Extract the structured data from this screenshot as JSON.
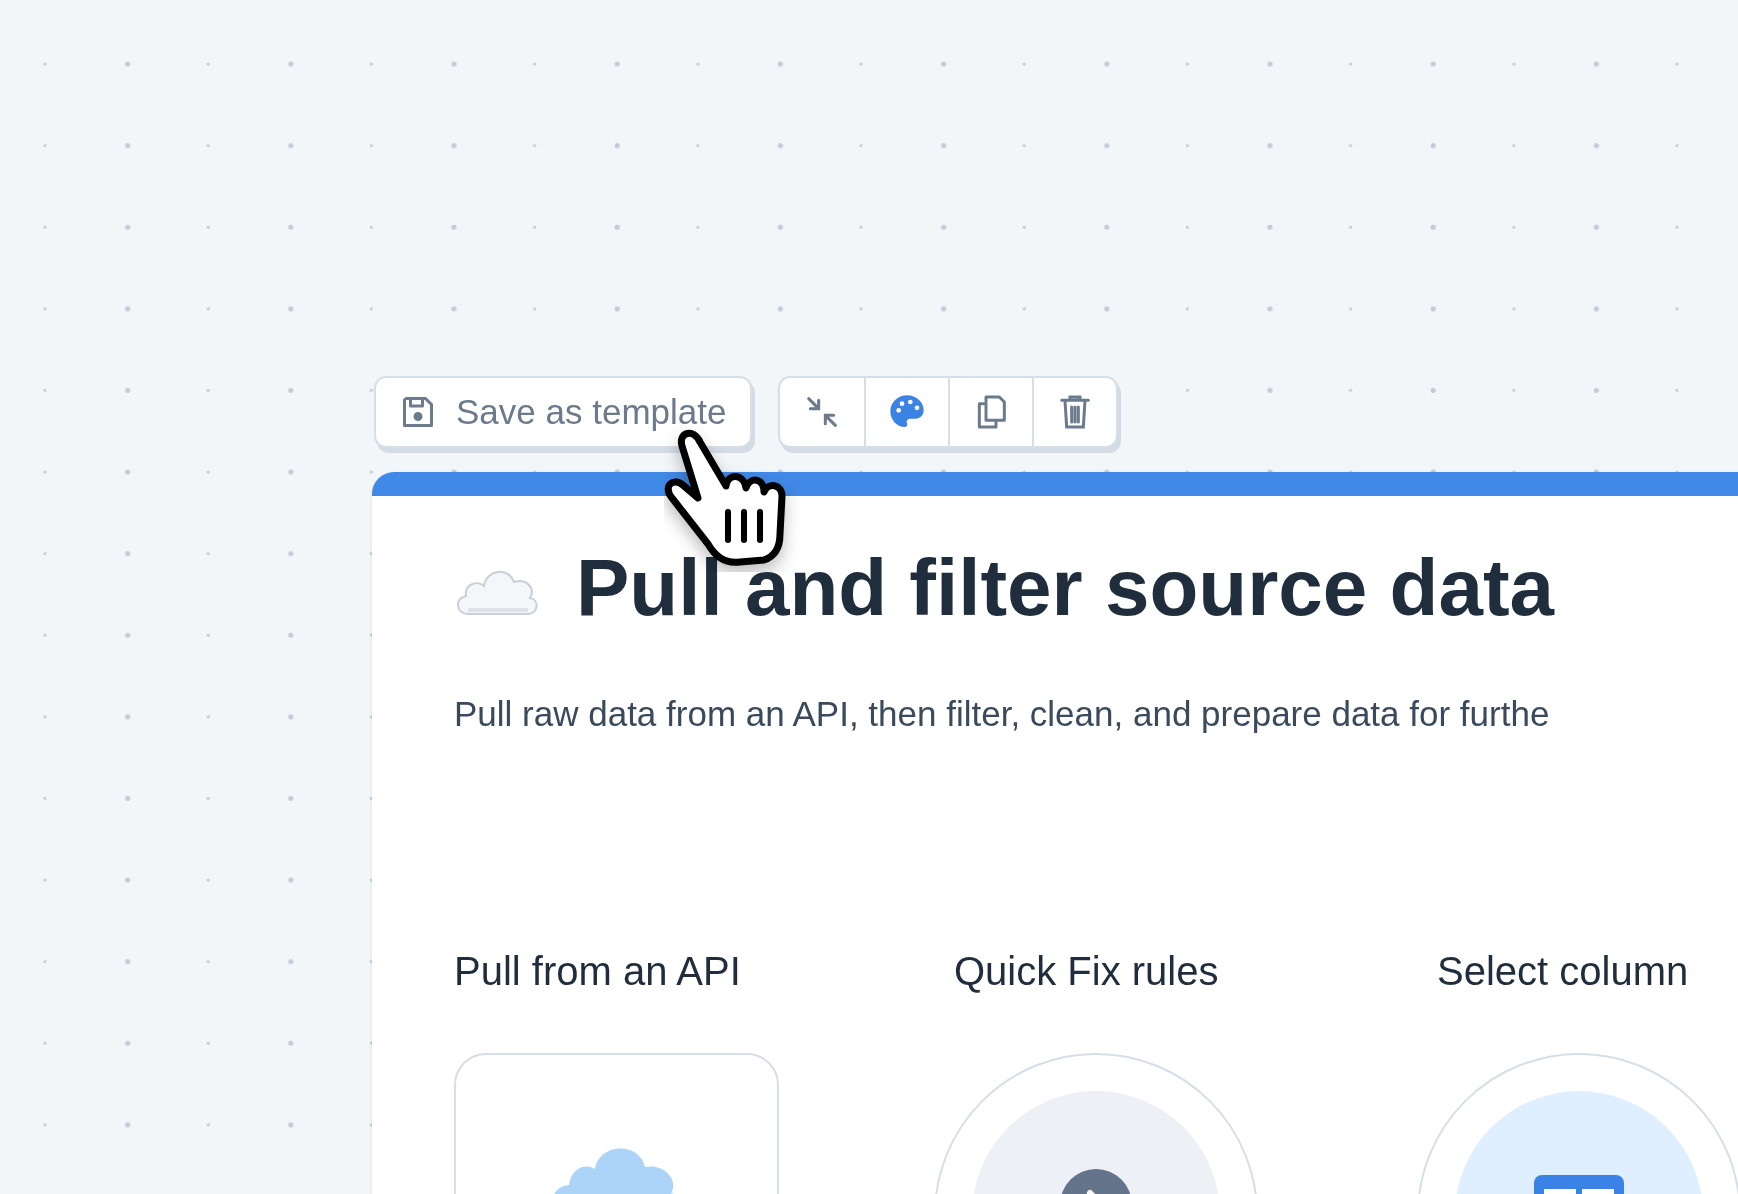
{
  "toolbar": {
    "save_button": {
      "label": "Save as template"
    },
    "icon_buttons": [
      {
        "kind": "collapse"
      },
      {
        "kind": "palette"
      },
      {
        "kind": "duplicate"
      },
      {
        "kind": "delete"
      }
    ]
  },
  "card": {
    "title": "Pull and filter source data",
    "description": "Pull raw data from an API, then filter, clean, and prepare data for furthe",
    "steps": [
      {
        "kind": "api",
        "label": "Pull from an API"
      },
      {
        "kind": "rules",
        "label": "Quick Fix rules"
      },
      {
        "kind": "columns",
        "label": "Select column"
      }
    ]
  }
}
